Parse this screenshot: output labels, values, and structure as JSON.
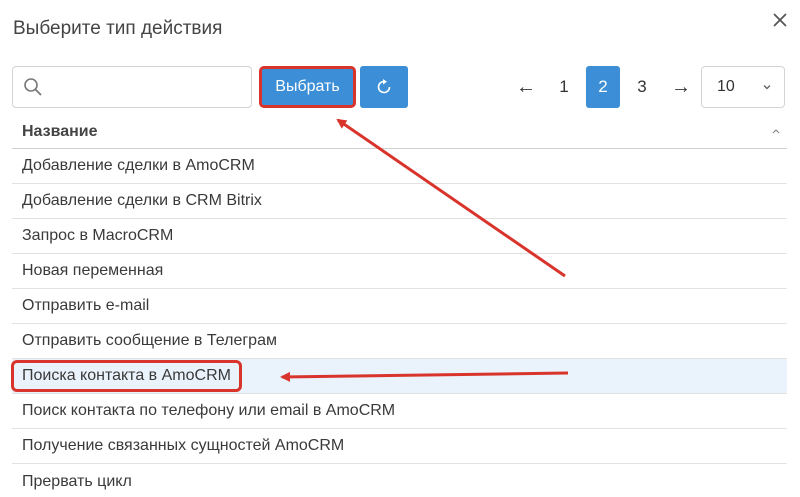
{
  "dialog": {
    "title": "Выберите тип действия",
    "close_icon": "close-icon"
  },
  "search": {
    "value": "",
    "placeholder": "",
    "icon": "search-icon"
  },
  "toolbar": {
    "select_label": "Выбрать",
    "refresh_icon": "refresh-icon"
  },
  "pagination": {
    "prev": "←",
    "pages": [
      "1",
      "2",
      "3"
    ],
    "current": "2",
    "next": "→",
    "per_page": "10"
  },
  "table": {
    "column": "Название",
    "rows": [
      "Добавление сделки в AmoCRM",
      "Добавление сделки в CRM Bitrix",
      "Запрос в MacroCRM",
      "Новая переменная",
      "Отправить e-mail",
      "Отправить сообщение в Телеграм",
      "Поиска контакта в AmoCRM",
      "Поиск контакта по телефону или email в AmoCRM",
      "Получение связанных сущностей AmoCRM",
      "Прервать цикл"
    ],
    "highlighted_row": 6
  },
  "colors": {
    "accent": "#3c8fd6",
    "annotation": "#d9342b",
    "row_highlight": "#eaf2fb"
  }
}
